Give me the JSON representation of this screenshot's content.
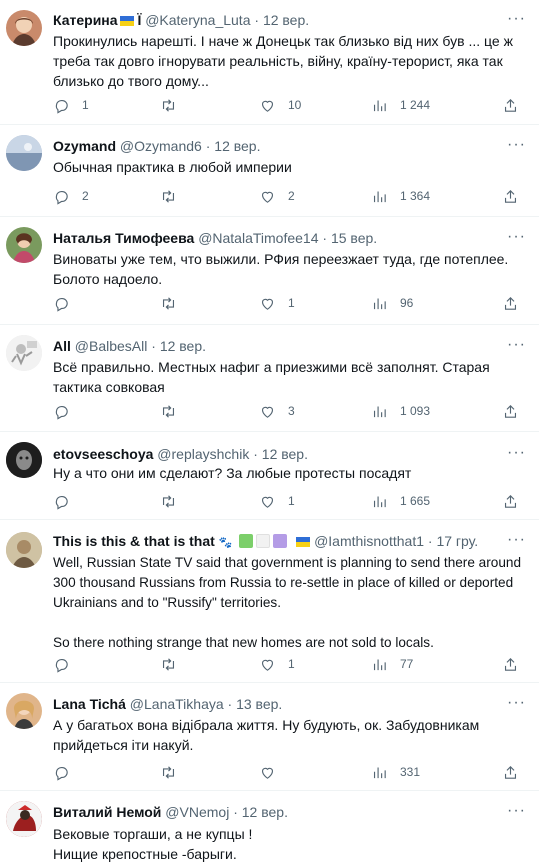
{
  "tweets": [
    {
      "name": "Катерина",
      "name_suffix": "Ї",
      "handle": "@Kateryna_Luta",
      "date": "12 вер.",
      "text": "Прокинулись нарешті. І наче ж Донецьк так близько від них був ... це ж треба так довго ігнорувати реальність, війну, країну-терорист, яка так близько до твого дому...",
      "replies": "1",
      "retweets": "",
      "likes": "10",
      "views": "1 244",
      "avatar_color": "#c98a6b"
    },
    {
      "name": "Ozymand",
      "handle": "@Ozymand6",
      "date": "12 вер.",
      "text": "Обычная практика в любой империи",
      "replies": "2",
      "retweets": "",
      "likes": "2",
      "views": "1 364",
      "avatar_color": "#9fb0c6"
    },
    {
      "name": "Наталья Тимофеева",
      "handle": "@NatalaTimofee14",
      "date": "15 вер.",
      "text": "Виноваты уже тем, что выжили. РФия переезжает туда, где потеплее. Болото надоело.",
      "replies": "",
      "retweets": "",
      "likes": "1",
      "views": "96",
      "avatar_color": "#7a9a5e"
    },
    {
      "name": "All",
      "handle": "@BalbesAll",
      "date": "12 вер.",
      "text": "Всё правильно. Местных нафиг а приезжими всё заполнят. Старая тактика совковая",
      "replies": "",
      "retweets": "",
      "likes": "3",
      "views": "1 093",
      "avatar_color": "#e6e6e6"
    },
    {
      "name": "etovseeschoya",
      "handle": "@replayshchik",
      "date": "12 вер.",
      "text": "Ну а что они им сделают? За любые протесты посадят",
      "replies": "",
      "retweets": "",
      "likes": "1",
      "views": "1 665",
      "avatar_color": "#2c2c2c"
    },
    {
      "name": "This is this & that is that",
      "handle": "@Iamthisnotthat1",
      "date": "17 гру.",
      "text": "Well, Russian State TV said that government is planning to send there around 300 thousand Russians from Russia to re-settle in place of killed or deported Ukrainians and to \"Russify\" territories.\n\nSo there nothing strange that new homes are not sold to locals.",
      "replies": "",
      "retweets": "",
      "likes": "1",
      "views": "77",
      "avatar_color": "#b8a27a"
    },
    {
      "name": "Lana Tichá",
      "handle": "@LanaTikhaya",
      "date": "13 вер.",
      "text": "А у багатьох вона відібрала життя. Ну будують, ок. Забудовникам прийдеться іти накуй.",
      "replies": "",
      "retweets": "",
      "likes": "",
      "views": "331",
      "avatar_color": "#e0b58a"
    },
    {
      "name": "Виталий Немой",
      "handle": "@VNemoj",
      "date": "12 вер.",
      "text": "Вековые торгаши, а не купцы !\nНищие крепостные -барыги.",
      "replies": "",
      "retweets": "",
      "likes": "",
      "views": "",
      "avatar_color": "#b02a2a"
    }
  ],
  "colors": {
    "accent": "#1d9bf0",
    "muted": "#536471",
    "divider": "#eff3f4",
    "square_green": "#7ccf6a",
    "square_purple": "#b49ce6"
  },
  "icons": [
    "reply-icon",
    "retweet-icon",
    "like-icon",
    "views-icon",
    "share-icon",
    "more-icon"
  ],
  "more_label": "···"
}
